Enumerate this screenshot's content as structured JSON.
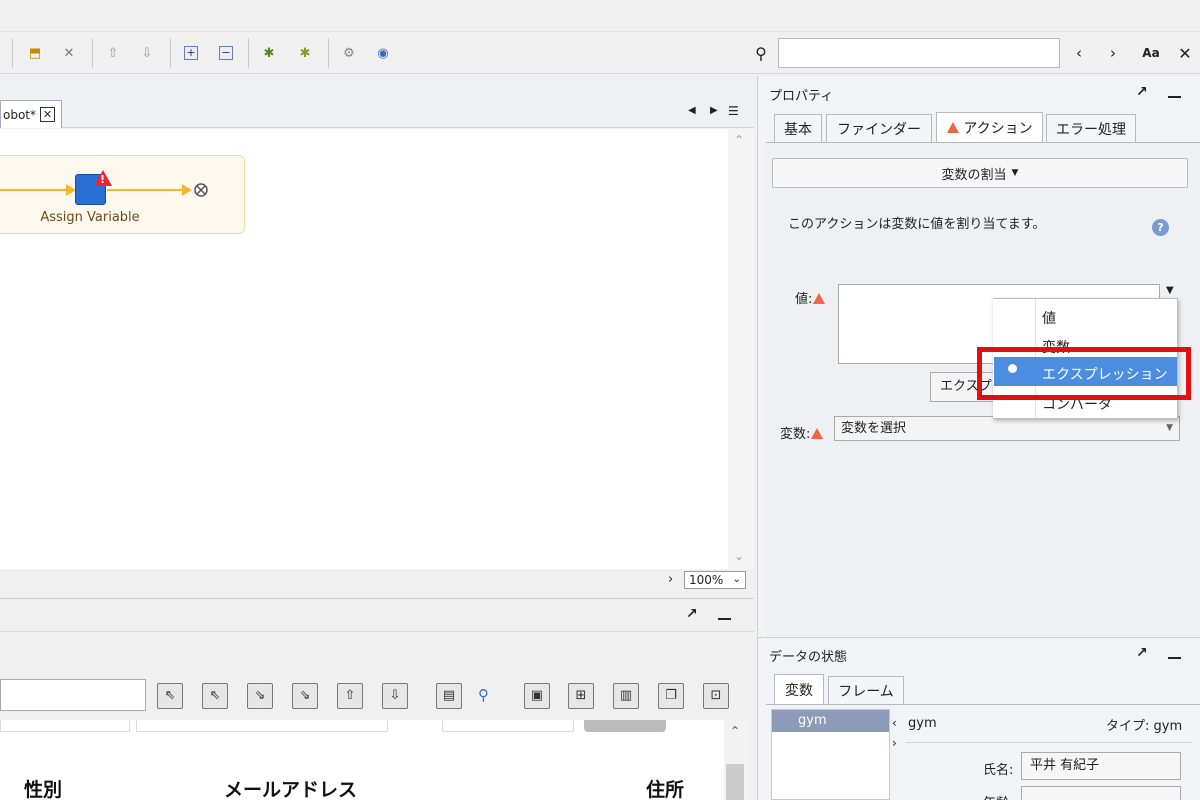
{
  "editor": {
    "tab_label": "obot*",
    "step_label": "Assign Variable",
    "zoom": "100%"
  },
  "bottom": {
    "columns": [
      "性別",
      "メールアドレス",
      "住所"
    ]
  },
  "properties": {
    "title": "プロパティ",
    "tabs": [
      {
        "label": "基本"
      },
      {
        "label": "ファインダー"
      },
      {
        "label": "アクション",
        "warning": true
      },
      {
        "label": "エラー処理"
      }
    ],
    "action_button": "変数の割当",
    "description": "このアクションは変数に値を割り当てます。",
    "value_label": "値:",
    "expr_button": "エクスプ",
    "variable_label": "変数:",
    "variable_select": "変数を選択",
    "dropdown_items": [
      "値",
      "変数",
      "エクスプレッション",
      "コンバータ"
    ],
    "dropdown_selected": "エクスプレッション"
  },
  "data_state": {
    "title": "データの状態",
    "tabs": [
      "変数",
      "フレーム"
    ],
    "list_item": "gym",
    "detail_name": "gym",
    "type_label": "タイプ: gym",
    "fields": [
      {
        "label": "氏名:",
        "value": "平井 有紀子"
      },
      {
        "label": "年齢:",
        "value": ""
      }
    ]
  },
  "colors": {
    "highlight": "#e01010",
    "selection": "#4d8de0",
    "node": "#2a6fd6"
  }
}
